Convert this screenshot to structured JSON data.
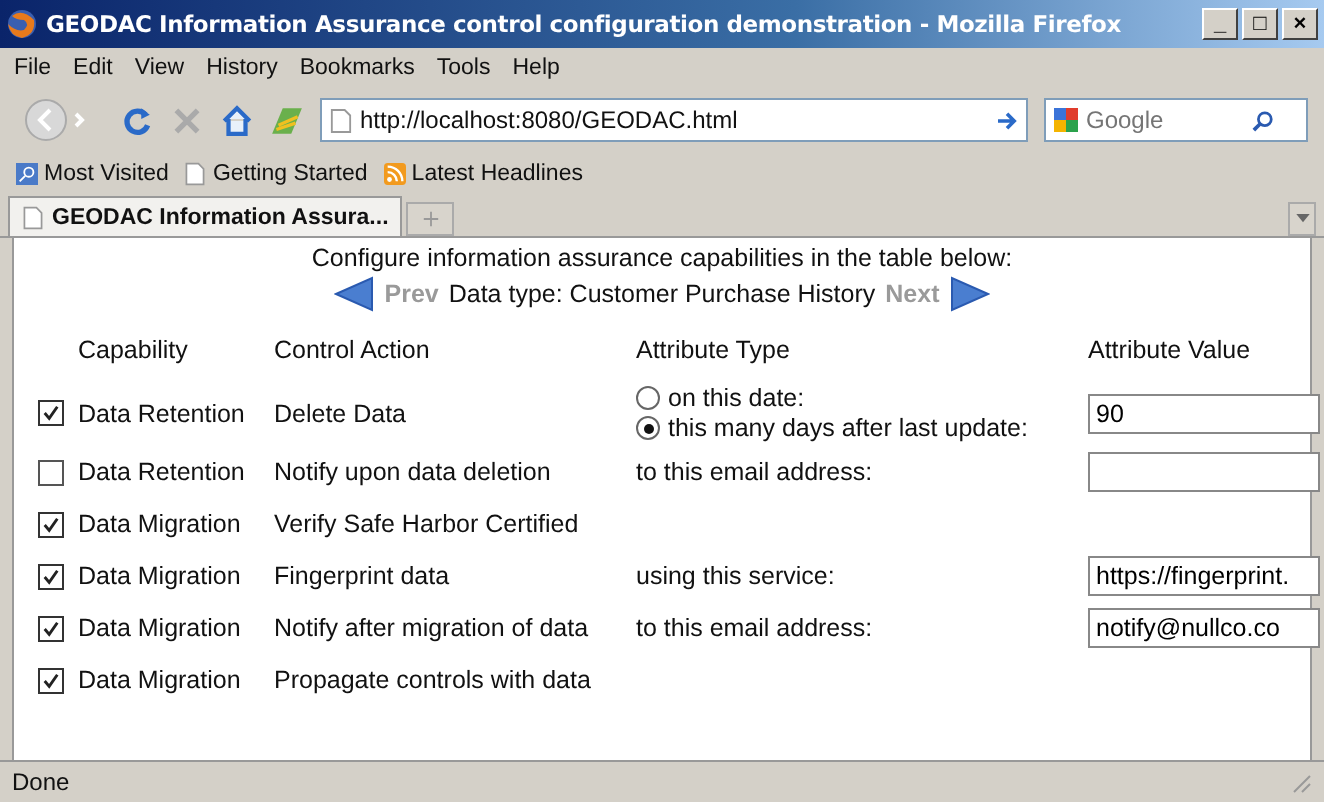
{
  "window": {
    "title": "GEODAC Information Assurance control configuration demonstration - Mozilla Firefox",
    "controls": [
      "_",
      "□",
      "×"
    ]
  },
  "menu": [
    "File",
    "Edit",
    "View",
    "History",
    "Bookmarks",
    "Tools",
    "Help"
  ],
  "address_bar": {
    "url": "http://localhost:8080/GEODAC.html"
  },
  "search": {
    "placeholder": "Google"
  },
  "bookmarks": [
    {
      "label": "Most Visited",
      "kind": "search"
    },
    {
      "label": "Getting Started",
      "kind": "page"
    },
    {
      "label": "Latest Headlines",
      "kind": "feed"
    }
  ],
  "tabs": [
    {
      "label": "GEODAC Information Assura...",
      "selected": true
    }
  ],
  "page": {
    "intro": "Configure information assurance capabilities in the table below:",
    "prev": "Prev",
    "data_type": "Data type: Customer Purchase History",
    "next": "Next",
    "columns": [
      "Capability",
      "Control Action",
      "Attribute Type",
      "Attribute Value"
    ],
    "rows": [
      {
        "checked": true,
        "capability": "Data Retention",
        "action": "Delete Data",
        "attribute": {
          "kind": "radio",
          "options": [
            {
              "label": "on this date:",
              "selected": false
            },
            {
              "label": "this many days after last update:",
              "selected": true
            }
          ]
        },
        "field": true,
        "value": "90"
      },
      {
        "checked": false,
        "capability": "Data Retention",
        "action": "Notify upon data deletion",
        "attribute": {
          "kind": "text",
          "label": "to this email address:"
        },
        "field": true
      },
      {
        "checked": true,
        "capability": "Data Migration",
        "action": "Verify Safe Harbor Certified",
        "field": false
      },
      {
        "checked": true,
        "capability": "Data Migration",
        "action": "Fingerprint data",
        "attribute": {
          "kind": "text",
          "label": "using this service:"
        },
        "field": true,
        "value": "https://fingerprint."
      },
      {
        "checked": true,
        "capability": "Data Migration",
        "action": "Notify after migration of data",
        "attribute": {
          "kind": "text",
          "label": "to this email address:"
        },
        "field": true,
        "value": "notify@nullco.co"
      },
      {
        "checked": true,
        "capability": "Data Migration",
        "action": "Propagate controls with data",
        "field": false
      }
    ]
  },
  "status_bar": {
    "text": "Done"
  }
}
